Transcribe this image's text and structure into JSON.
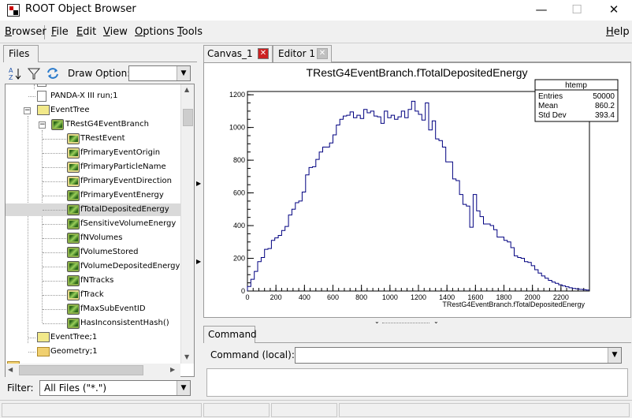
{
  "window": {
    "title": "ROOT Object Browser",
    "minimize": "—",
    "maximize": "☐",
    "close": "✕"
  },
  "menu": {
    "browser": "Browser",
    "file": "File",
    "edit": "Edit",
    "view": "View",
    "options": "Options",
    "tools": "Tools",
    "help": "Help",
    "browser_u": "B",
    "browser_rest": "rowser",
    "file_u": "F",
    "file_rest": "ile",
    "edit_u": "E",
    "edit_rest": "dit",
    "view_u": "V",
    "view_rest": "iew",
    "options_u": "O",
    "options_rest": "ptions",
    "tools_u": "T",
    "tools_rest": "ools",
    "help_u": "H",
    "help_rest": "elp"
  },
  "left_panel": {
    "tab": "Files",
    "draw_option_label": "Draw Option:",
    "draw_option_value": "",
    "filter_label": "Filter:",
    "filter_value": "All Files (\"*.\")"
  },
  "tree": {
    "items": [
      {
        "label": "PANDA-X III run;1"
      },
      {
        "label": "EventTree"
      },
      {
        "label": "TRestG4EventBranch"
      },
      {
        "label": "TRestEvent"
      },
      {
        "label": "fPrimaryEventOrigin"
      },
      {
        "label": "fPrimaryParticleName"
      },
      {
        "label": "fPrimaryEventDirection"
      },
      {
        "label": "fPrimaryEventEnergy"
      },
      {
        "label": "fTotalDepositedEnergy"
      },
      {
        "label": "fSensitiveVolumeEnergy"
      },
      {
        "label": "fNVolumes"
      },
      {
        "label": "fVolumeStored"
      },
      {
        "label": "fVolumeDepositedEnergy"
      },
      {
        "label": "fNTracks"
      },
      {
        "label": "fTrack"
      },
      {
        "label": "fMaxSubEventID"
      },
      {
        "label": "HasInconsistentHash()"
      },
      {
        "label": "EventTree;1"
      },
      {
        "label": "Geometry;1"
      }
    ],
    "selected_index": 8
  },
  "tabs": {
    "canvas": "Canvas_1",
    "editor": "Editor 1"
  },
  "command": {
    "tab": "Command",
    "label": "Command (local):",
    "value": ""
  },
  "stats": {
    "title": "htemp",
    "rows": [
      {
        "label": "Entries",
        "value": "50000"
      },
      {
        "label": "Mean",
        "value": "860.2"
      },
      {
        "label": "Std Dev",
        "value": "393.4"
      }
    ]
  },
  "colors": {
    "histogram": "#000080",
    "close_red": "#cc2222",
    "close_gray": "#c0c0c0"
  },
  "chart_data": {
    "type": "histogram",
    "title": "TRestG4EventBranch.fTotalDepositedEnergy",
    "xlabel": "TRestG4EventBranch.fTotalDepositedEnergy",
    "ylabel": "",
    "xlim": [
      0,
      2400
    ],
    "ylim": [
      0,
      1220
    ],
    "bin_width": 24,
    "x_ticks": [
      0,
      200,
      400,
      600,
      800,
      1000,
      1200,
      1400,
      1600,
      1800,
      2000,
      2200
    ],
    "y_ticks": [
      0,
      200,
      400,
      600,
      800,
      1000,
      1200
    ],
    "counts": [
      28,
      72,
      120,
      180,
      205,
      255,
      260,
      310,
      325,
      340,
      370,
      395,
      465,
      500,
      540,
      550,
      605,
      710,
      755,
      760,
      805,
      850,
      880,
      880,
      905,
      955,
      1015,
      1050,
      1070,
      1075,
      1095,
      1060,
      1075,
      1055,
      1110,
      1090,
      1100,
      1070,
      1065,
      1025,
      1100,
      1060,
      1075,
      1050,
      1065,
      1100,
      1060,
      1110,
      1160,
      1100,
      1080,
      1045,
      1150,
      985,
      1040,
      930,
      920,
      880,
      790,
      790,
      685,
      675,
      590,
      530,
      520,
      390,
      590,
      490,
      455,
      410,
      410,
      400,
      375,
      330,
      330,
      310,
      300,
      265,
      215,
      205,
      200,
      180,
      175,
      155,
      130,
      110,
      92,
      78,
      65,
      55,
      47,
      38,
      32,
      26,
      20,
      16,
      13,
      10,
      8,
      6,
      5,
      4,
      3,
      2,
      2,
      1,
      1,
      1,
      1,
      0
    ]
  }
}
